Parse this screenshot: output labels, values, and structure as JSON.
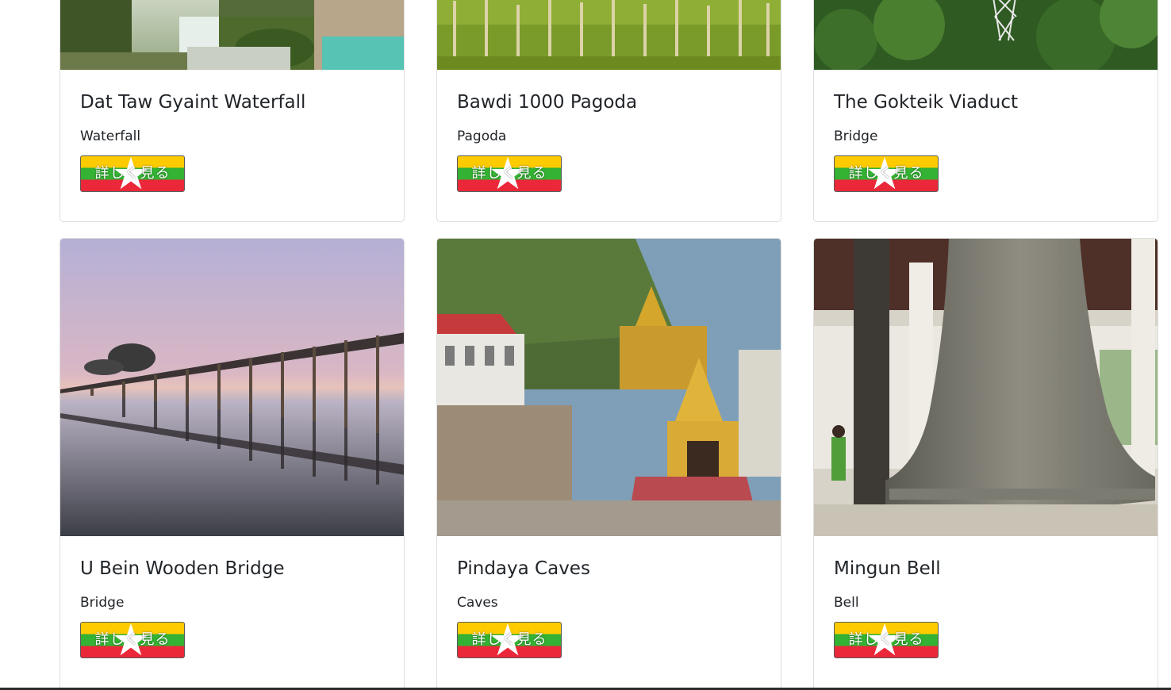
{
  "colors": {
    "flag_yellow": "#fecb00",
    "flag_green": "#34b233",
    "flag_red": "#ea2839",
    "star": "#ffffff"
  },
  "cards": [
    {
      "title": "Dat Taw Gyaint Waterfall",
      "category": "Waterfall",
      "button_label": "詳しく見る",
      "image": "waterfall-photo"
    },
    {
      "title": "Bawdi 1000 Pagoda",
      "category": "Pagoda",
      "button_label": "詳しく見る",
      "image": "pagoda-field-photo"
    },
    {
      "title": "The Gokteik Viaduct",
      "category": "Bridge",
      "button_label": "詳しく見る",
      "image": "jungle-viaduct-photo"
    },
    {
      "title": "U Bein Wooden Bridge",
      "category": "Bridge",
      "button_label": "詳しく見る",
      "image": "wooden-bridge-reflection-photo"
    },
    {
      "title": "Pindaya Caves",
      "category": "Caves",
      "button_label": "詳しく見る",
      "image": "cave-temple-photo"
    },
    {
      "title": "Mingun Bell",
      "category": "Bell",
      "button_label": "詳しく見る",
      "image": "giant-bell-photo"
    }
  ]
}
